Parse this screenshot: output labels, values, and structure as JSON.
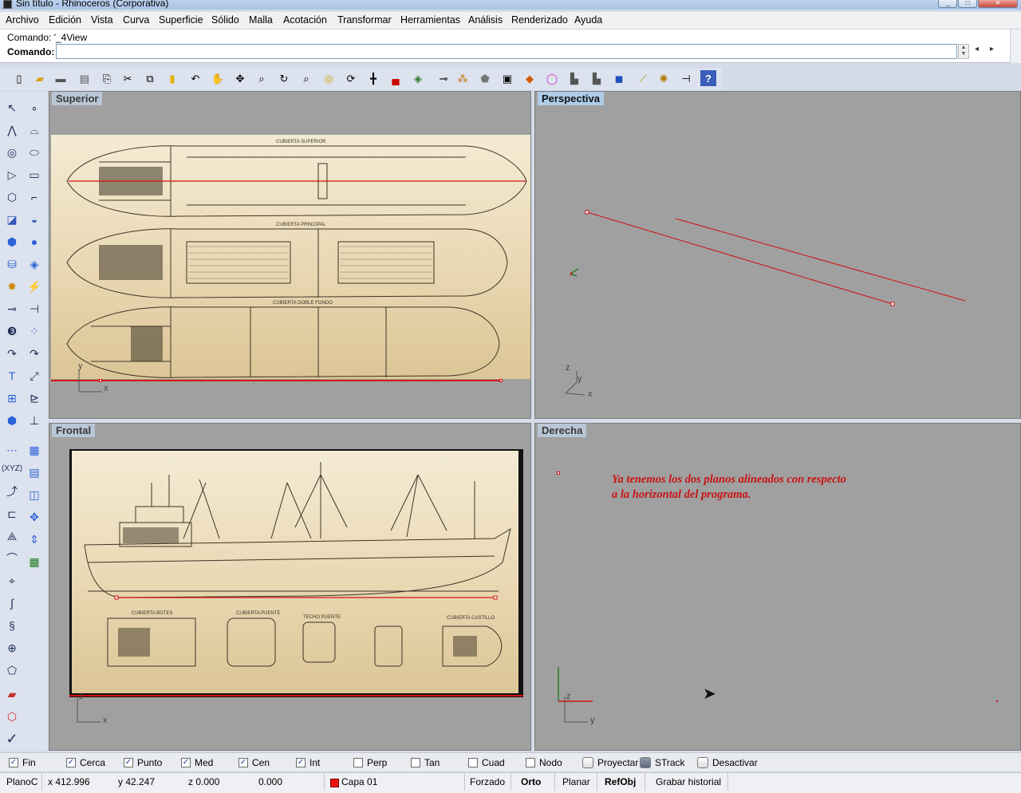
{
  "window": {
    "title": "Sin título - Rhinoceros (Corporativa)",
    "buttons": [
      "minimize",
      "maximize",
      "close"
    ]
  },
  "menu": [
    "Archivo",
    "Edición",
    "Vista",
    "Curva",
    "Superficie",
    "Sólido",
    "Malla",
    "Acotación",
    "Transformar",
    "Herramientas",
    "Análisis",
    "Renderizado",
    "Ayuda"
  ],
  "command": {
    "history": "Comando: '_4View",
    "label": "Comando:",
    "value": ""
  },
  "toolbar_icons": [
    "new-icon",
    "open-icon",
    "save-icon",
    "print-icon",
    "clipboard-icon",
    "cut-icon",
    "copy-icon",
    "paste-icon",
    "undo-icon",
    "pan-icon",
    "move-view-icon",
    "zoom-window-icon",
    "rotate-view-icon",
    "zoom-icon",
    "zoom-extents-icon",
    "zoom-selected-icon",
    "grid-icon",
    "car-icon",
    "layers-icon",
    "snap-icon",
    "points-icon",
    "shade-icon",
    "display-icon",
    "render-icon",
    "color-wheel-icon",
    "light-icon",
    "light-2-icon",
    "material-icon",
    "wand-icon",
    "sun-icon",
    "pin-icon",
    "help-icon"
  ],
  "left_tool_icons": [
    "select-arrow-icon",
    "point-icon",
    "polyline-icon",
    "curve-icon",
    "circle-icon",
    "ellipse-icon",
    "arc-icon",
    "rectangle-icon",
    "polygon-icon",
    "fillet-icon",
    "surface-icon",
    "revolve-icon",
    "box-icon",
    "sphere-icon",
    "cylinder-icon",
    "planar-surface-icon",
    "explode-icon",
    "trim-icon",
    "split-icon",
    "extend-icon",
    "boolean-icon",
    "offset-icon",
    "curve-tools-icon",
    "blend-icon",
    "text-icon",
    "dimension-icon",
    "array-icon",
    "analysis-icon",
    "solid-tools-icon",
    "dimension-2-icon",
    "align-icon",
    "cplane-icon",
    "xyz-icon",
    "cplane-2-icon",
    "transform-icon",
    "rotate-icon",
    "scale-icon",
    "mirror-icon",
    "orient-icon",
    "move-icon",
    "curvature-icon",
    "render-2-icon",
    "edit-icon",
    "history-icon",
    "blend-2-icon",
    "check-icon",
    "shade-toggle-icon",
    "render-mode-icon"
  ],
  "viewports": {
    "top": {
      "title": "Superior",
      "axis_x": "x",
      "axis_y": "y"
    },
    "perspective": {
      "title": "Perspectiva",
      "axis_x": "x",
      "axis_y": "y",
      "axis_z": "z"
    },
    "front": {
      "title": "Frontal",
      "axis_x": "x",
      "axis_z": "z"
    },
    "right": {
      "title": "Derecha",
      "axis_y": "y",
      "axis_z": "z",
      "annotation_line1": "Ya tenemos los dos planos alineados con respecto",
      "annotation_line2": "a la horizontal del programa."
    }
  },
  "blueprint_labels": {
    "top_1": "CUBIERTA SUPERIOR",
    "top_2": "CUBIERTA PRINCIPAL",
    "top_3": "CUBIERTA DOBLE FONDO",
    "front_1": "CUBIERTA BOTES",
    "front_2": "CUBIERTA PUENTE",
    "front_3": "TECHO PUENTE",
    "front_4": "CUBIERTA CASTILLO"
  },
  "osnaps": [
    {
      "label": "Fin",
      "checked": true
    },
    {
      "label": "Cerca",
      "checked": true
    },
    {
      "label": "Punto",
      "checked": true
    },
    {
      "label": "Med",
      "checked": true
    },
    {
      "label": "Cen",
      "checked": true
    },
    {
      "label": "Int",
      "checked": true
    },
    {
      "label": "Perp",
      "checked": false
    },
    {
      "label": "Tan",
      "checked": false
    },
    {
      "label": "Cuad",
      "checked": false
    },
    {
      "label": "Nodo",
      "checked": false
    }
  ],
  "toggles": [
    {
      "label": "Proyectar",
      "on": false
    },
    {
      "label": "STrack",
      "on": true
    },
    {
      "label": "Desactivar",
      "on": false
    }
  ],
  "status": {
    "cplane": "PlanoC",
    "x": "x 412.996",
    "y": "y 42.247",
    "z": "z 0.000",
    "dist": "0.000",
    "layer": "Capa 01",
    "layer_color": "#e11111",
    "forzado": "Forzado",
    "orto": "Orto",
    "planar": "Planar",
    "refobj": "RefObj",
    "history": "Grabar historial"
  }
}
